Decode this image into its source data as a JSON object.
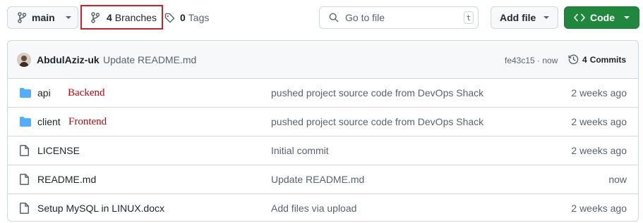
{
  "toolbar": {
    "branch_label": "main",
    "branches_count": "4",
    "branches_label": "Branches",
    "tags_count": "0",
    "tags_label": "Tags",
    "search_placeholder": "Go to file",
    "search_shortcut": "t",
    "add_file_label": "Add file",
    "code_label": "Code"
  },
  "commit": {
    "author": "AbdulAziz-uk",
    "message": "Update README.md",
    "hash": "fe43c15",
    "separator": " · ",
    "time": "now",
    "commits_count": "4",
    "commits_label": "Commits"
  },
  "files": [
    {
      "name": "api",
      "type": "folder",
      "note": "Backend",
      "message": "pushed project source code from DevOps Shack",
      "age": "2 weeks ago"
    },
    {
      "name": "client",
      "type": "folder",
      "note": "Frontend",
      "message": "pushed project source code from DevOps Shack",
      "age": "2 weeks ago"
    },
    {
      "name": "LICENSE",
      "type": "file",
      "note": "",
      "message": "Initial commit",
      "age": "2 weeks ago"
    },
    {
      "name": "README.md",
      "type": "file",
      "note": "",
      "message": "Update README.md",
      "age": "now"
    },
    {
      "name": "Setup MySQL in LINUX.docx",
      "type": "file",
      "note": "",
      "message": "Add files via upload",
      "age": "2 weeks ago"
    }
  ],
  "colors": {
    "code_button": "#1f883d",
    "annotation": "#cf2027",
    "folder_icon": "#54aeff",
    "handwritten_note": "#c0000c"
  }
}
